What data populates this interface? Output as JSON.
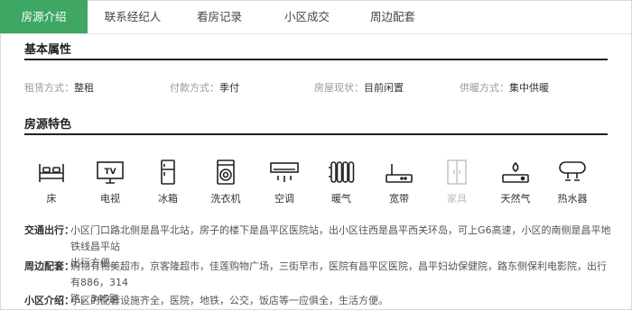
{
  "tabs": [
    "房源介绍",
    "联系经纪人",
    "看房记录",
    "小区成交",
    "周边配套"
  ],
  "basic": {
    "title": "基本属性",
    "attrs": [
      {
        "label": "租赁方式：",
        "value": "整租"
      },
      {
        "label": "付款方式：",
        "value": "季付"
      },
      {
        "label": "房屋现状：",
        "value": "目前闲置"
      },
      {
        "label": "供暖方式：",
        "value": "集中供暖"
      }
    ]
  },
  "features": {
    "title": "房源特色",
    "items": [
      {
        "icon": "bed-icon",
        "label": "床",
        "available": true
      },
      {
        "icon": "tv-icon",
        "label": "电视",
        "available": true
      },
      {
        "icon": "fridge-icon",
        "label": "冰箱",
        "available": true
      },
      {
        "icon": "washer-icon",
        "label": "洗衣机",
        "available": true
      },
      {
        "icon": "air-conditioner-icon",
        "label": "空调",
        "available": true
      },
      {
        "icon": "radiator-icon",
        "label": "暖气",
        "available": true
      },
      {
        "icon": "router-icon",
        "label": "宽带",
        "available": true
      },
      {
        "icon": "wardrobe-icon",
        "label": "家具",
        "available": false
      },
      {
        "icon": "gas-stove-icon",
        "label": "天然气",
        "available": true
      },
      {
        "icon": "water-heater-icon",
        "label": "热水器",
        "available": true
      }
    ]
  },
  "details": {
    "traffic": {
      "label": "交通出行：",
      "lines": [
        "小区门口路北侧是昌平北站，房子的楼下是昌平区医院站，出小区往西是昌平西关环岛，可上G6高速，小区的南侧是昌平地铁线昌平站",
        "出行方便。"
      ]
    },
    "nearby": {
      "label": "周边配套：",
      "lines": [
        "购物有物美超市，京客隆超市，佳莲购物广场，三街早市，医院有昌平区医院，昌平妇幼保健院，路东侧保利电影院，出行有886，314",
        "路，345路"
      ]
    },
    "community": {
      "label": "小区介绍：",
      "lines": [
        "小区的配套设施齐全，医院，地铁，公交，饭店等一应俱全，生活方便。"
      ]
    }
  },
  "colors": {
    "accent": "#3da763",
    "disabled": "#bbbbbb"
  }
}
